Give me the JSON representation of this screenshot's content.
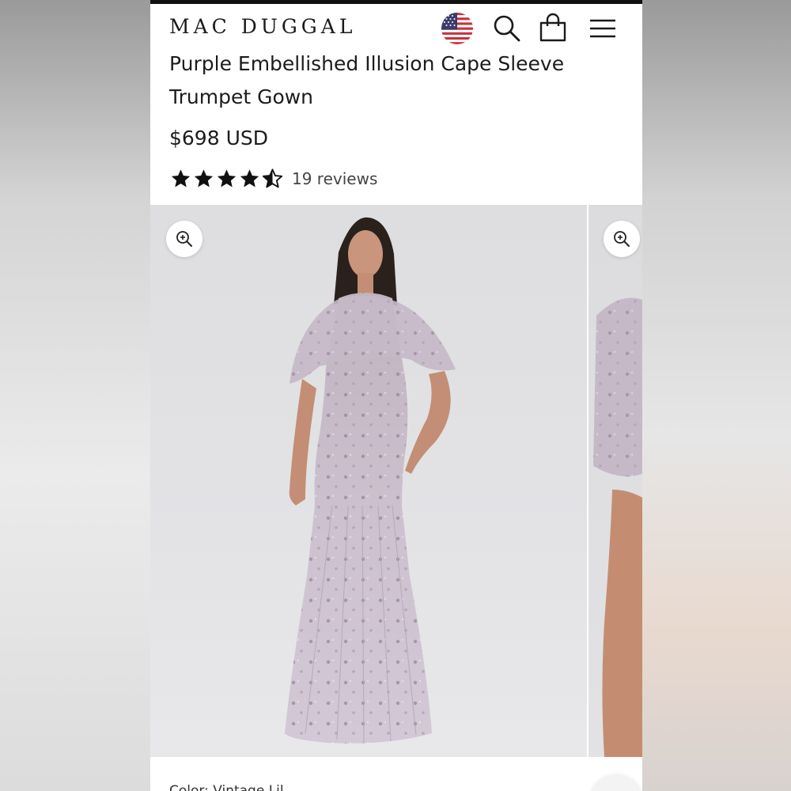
{
  "header": {
    "logo": "MAC DUGGAL",
    "icons": [
      "us-flag-icon",
      "search-icon",
      "shopping-bag-icon",
      "hamburger-menu-icon"
    ]
  },
  "product": {
    "title": "Purple Embellished Illusion Cape Sleeve Trumpet Gown",
    "price": "$698 USD",
    "rating": 4.5,
    "rating_max": 5,
    "reviews": "19 reviews",
    "color_label": "Color: Vintage Lil"
  },
  "gallery": {
    "images": [
      "gown-front-image",
      "gown-side-image"
    ],
    "zoom_icon": "zoom-in-icon"
  },
  "colors": {
    "text": "#1c1c1c",
    "gown": "#c9bcc9",
    "background": "#ffffff"
  }
}
